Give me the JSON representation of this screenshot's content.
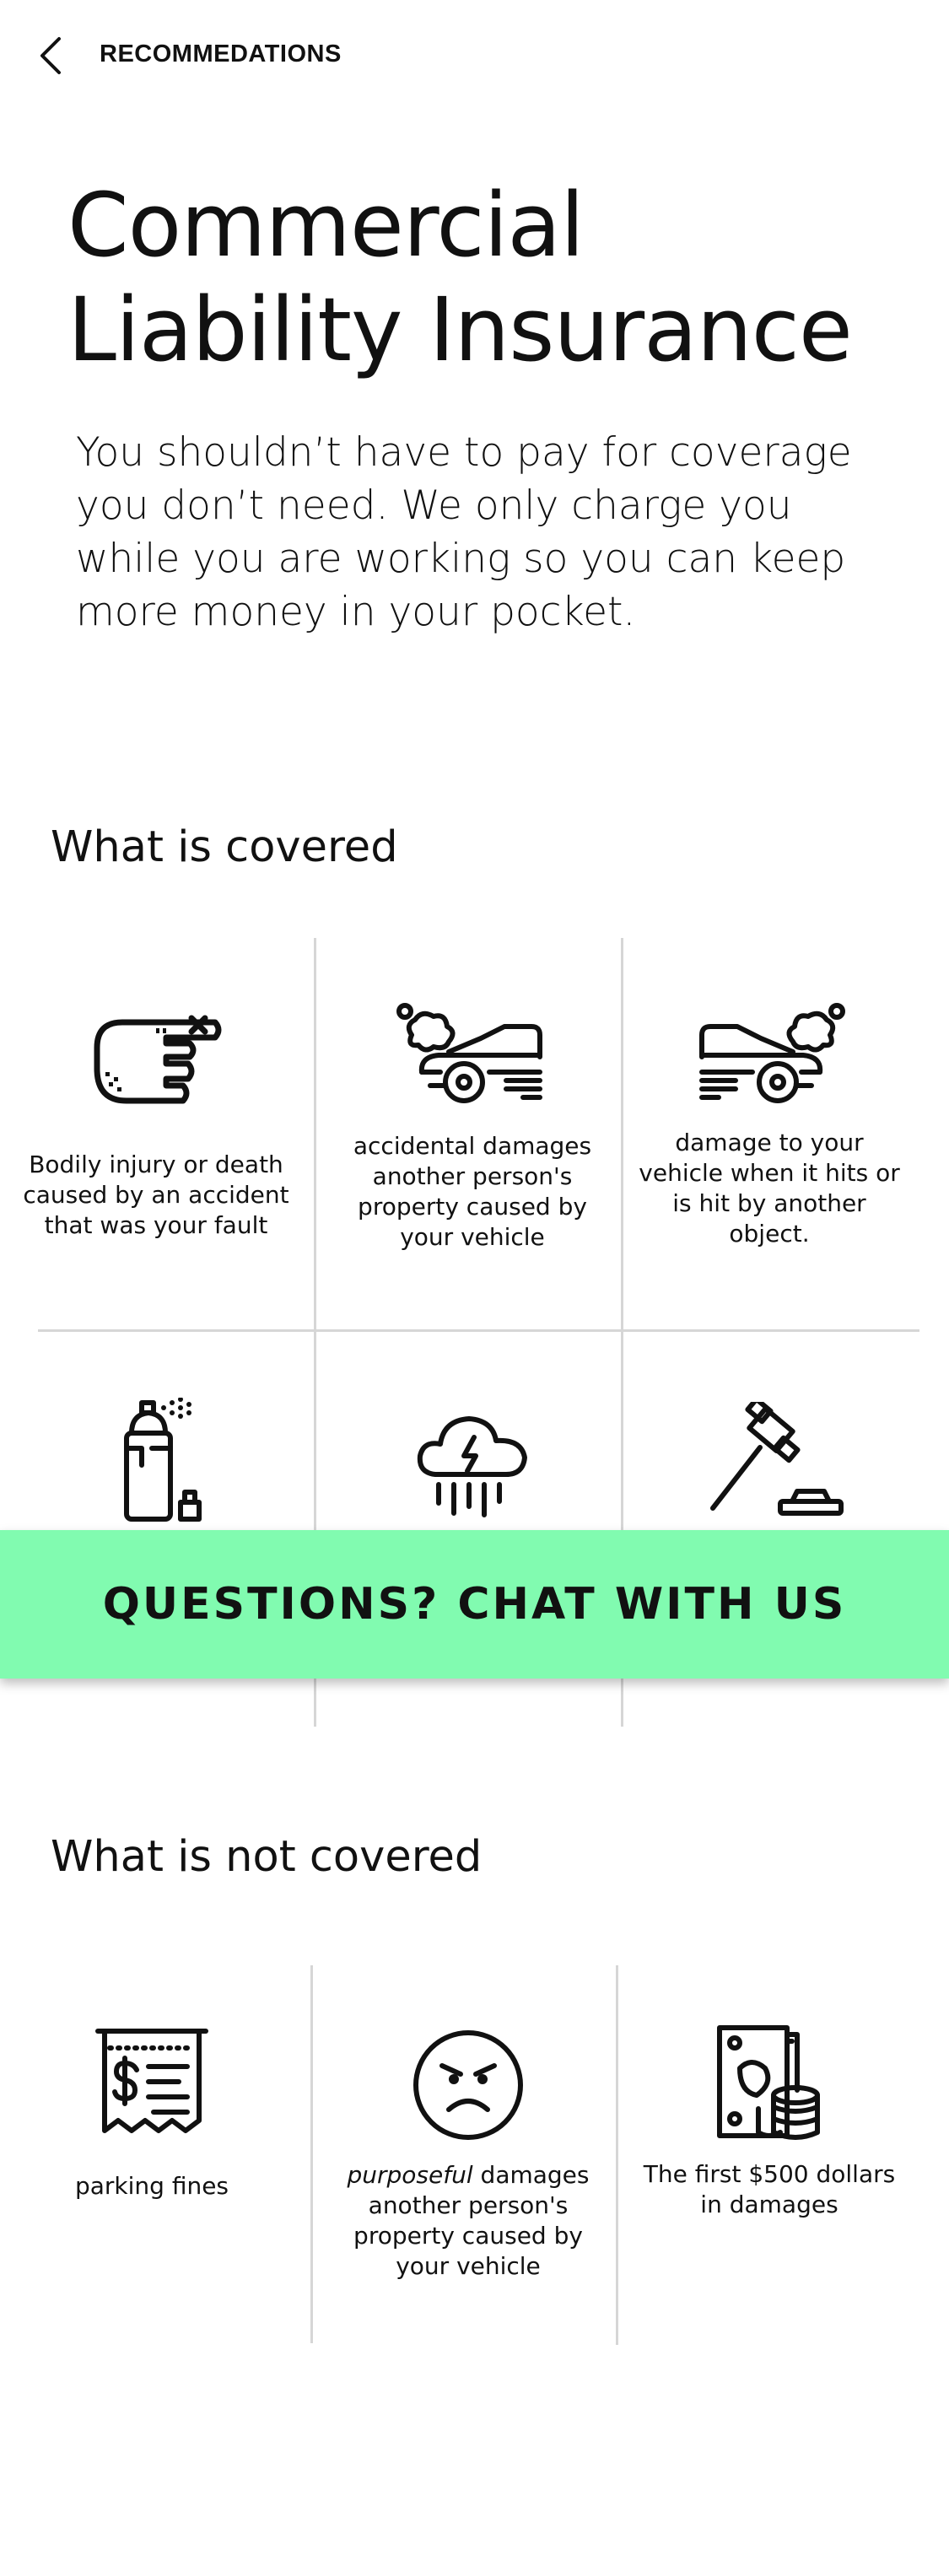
{
  "header": {
    "back_icon": "chevron-left-icon",
    "title": "RECOMMEDATIONS"
  },
  "page": {
    "title": "Commercial\nLiability Insurance",
    "intro": "You shouldn’t have to pay for coverage you don’t need.  We only charge you while you are working so you can keep more money in your pocket."
  },
  "covered": {
    "heading": "What is covered",
    "items": [
      {
        "icon": "bandaged-hand-icon",
        "caption": "Bodily injury or death caused by an accident that was your fault"
      },
      {
        "icon": "car-crash-left-icon",
        "caption": "accidental damages another person's property caused by your vehicle"
      },
      {
        "icon": "car-crash-right-icon",
        "caption": "damage to your vehicle when it hits or is hit by another object."
      },
      {
        "icon": "spray-paint-icon",
        "caption": ""
      },
      {
        "icon": "storm-cloud-icon",
        "caption": ""
      },
      {
        "icon": "gavel-icon",
        "caption": ""
      }
    ]
  },
  "not_covered": {
    "heading": "What is not covered",
    "items": [
      {
        "icon": "parking-ticket-icon",
        "caption": "parking fines"
      },
      {
        "icon": "angry-face-icon",
        "caption_em": "purposeful",
        "caption": " damages another person's property caused by your vehicle"
      },
      {
        "icon": "money-coins-icon",
        "caption": "The first $500 dollars in damages"
      }
    ]
  },
  "cta": {
    "label": "QUESTIONS? CHAT WITH US",
    "color": "#81fbb0"
  }
}
